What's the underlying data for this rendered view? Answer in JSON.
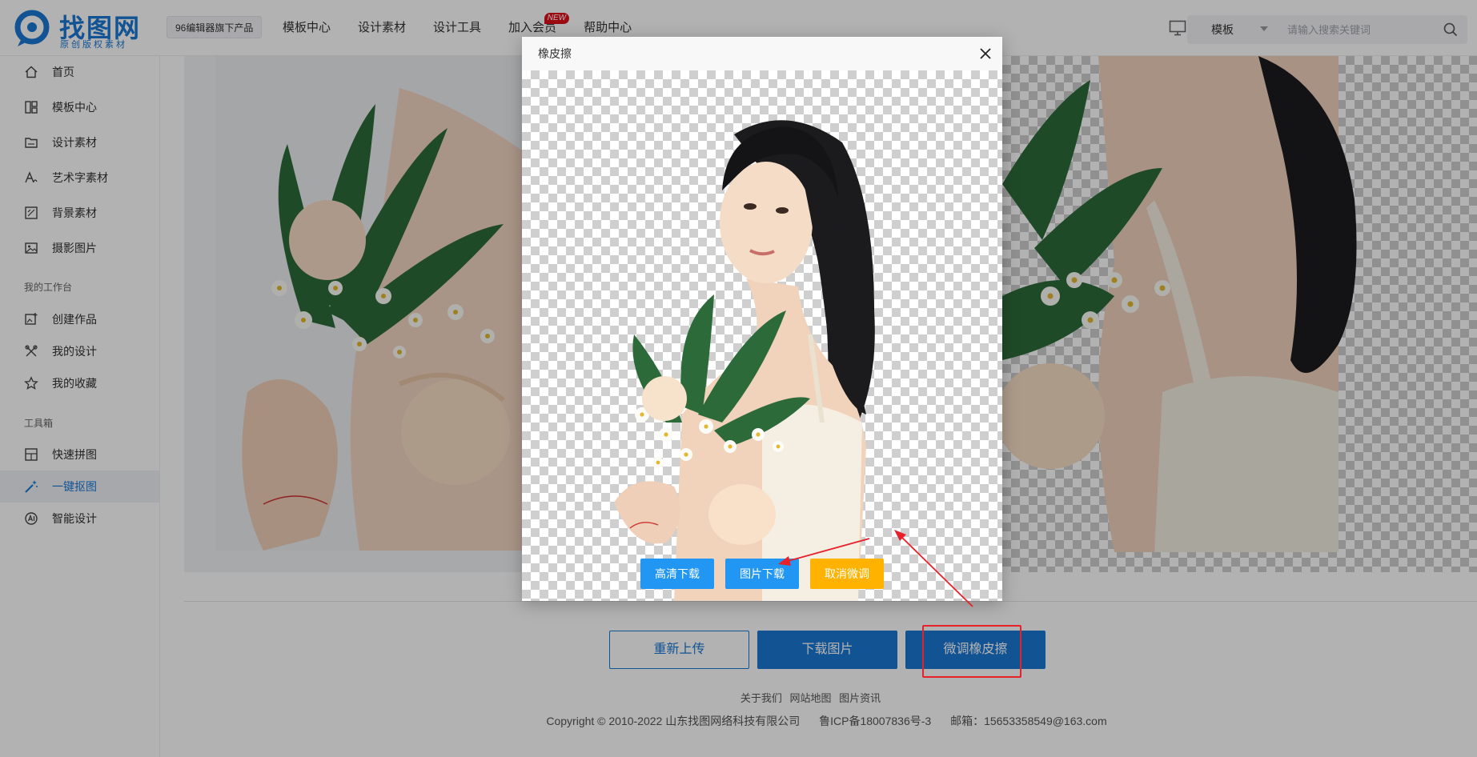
{
  "header": {
    "logo_text": "找图网",
    "logo_sub": "原创版权素材",
    "product_tag": "96编辑器旗下产品",
    "nav": [
      {
        "label": "模板中心"
      },
      {
        "label": "设计素材"
      },
      {
        "label": "设计工具"
      },
      {
        "label": "加入会员",
        "badge": "NEW"
      },
      {
        "label": "帮助中心"
      }
    ],
    "search": {
      "type_label": "模板",
      "placeholder": "请输入搜索关键词"
    }
  },
  "sidebar": {
    "items": [
      {
        "label": "首页",
        "icon": "home-icon"
      },
      {
        "label": "模板中心",
        "icon": "template-icon"
      },
      {
        "label": "设计素材",
        "icon": "material-icon"
      },
      {
        "label": "艺术字素材",
        "icon": "font-art-icon"
      },
      {
        "label": "背景素材",
        "icon": "background-icon"
      },
      {
        "label": "摄影图片",
        "icon": "photo-icon"
      }
    ],
    "section_workspace": "我的工作台",
    "workspace_items": [
      {
        "label": "创建作品",
        "icon": "create-icon"
      },
      {
        "label": "我的设计",
        "icon": "design-icon"
      },
      {
        "label": "我的收藏",
        "icon": "star-icon"
      }
    ],
    "section_tools": "工具箱",
    "tool_items": [
      {
        "label": "快速拼图",
        "icon": "collage-icon"
      },
      {
        "label": "一键抠图",
        "icon": "magic-wand-icon",
        "active": true
      },
      {
        "label": "智能设计",
        "icon": "ai-design-icon"
      }
    ]
  },
  "main": {
    "buttons": {
      "reupload": "重新上传",
      "download": "下载图片",
      "fine_tune": "微调橡皮擦"
    },
    "footer": {
      "links": [
        "关于我们",
        "网站地图",
        "图片资讯"
      ],
      "copyright": "Copyright © 2010-2022 山东找图网络科技有限公司",
      "icp": "鲁ICP备18007836号-3",
      "email": "邮箱：15653358549@163.com"
    }
  },
  "modal": {
    "title": "橡皮擦",
    "buttons": {
      "hd_download": "高清下载",
      "image_download": "图片下载",
      "cancel_tune": "取消微调"
    }
  },
  "colors": {
    "brand": "#1a78d4",
    "modal_blue": "#2196f3",
    "modal_yellow": "#ffb300",
    "annotation_red": "#e8202a"
  }
}
